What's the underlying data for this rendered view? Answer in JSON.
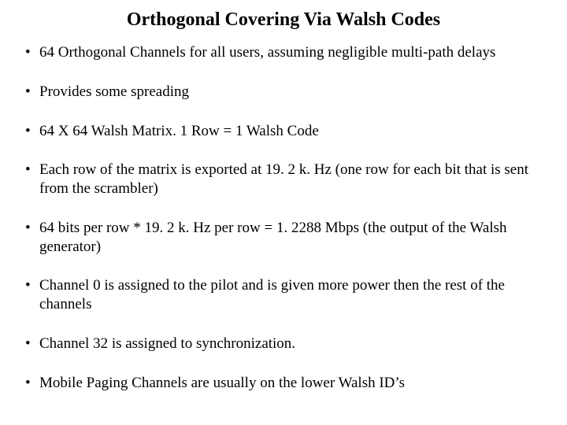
{
  "title": "Orthogonal Covering Via Walsh Codes",
  "bullets": [
    "64 Orthogonal Channels for all users, assuming negligible multi-path delays",
    "Provides some spreading",
    "64 X 64 Walsh Matrix.  1 Row = 1 Walsh Code",
    "Each row of the matrix is exported at 19. 2 k. Hz (one row for each bit that is sent from the scrambler)",
    "64 bits per row * 19. 2 k. Hz per row = 1. 2288 Mbps (the output of the Walsh generator)",
    "Channel 0 is assigned to the pilot and is given more power then the rest of the channels",
    "Channel 32 is assigned to synchronization.",
    "Mobile Paging Channels are usually on the lower Walsh ID’s"
  ]
}
